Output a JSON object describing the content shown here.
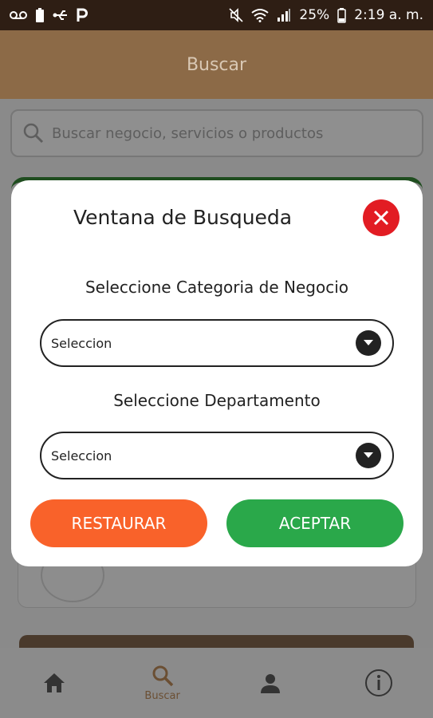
{
  "status_bar": {
    "left_icons": [
      "voicemail-icon",
      "battery-saver-icon",
      "usb-icon",
      "parking-icon"
    ],
    "battery": "25%",
    "time": "2:19 a. m."
  },
  "app_bar": {
    "title": "Buscar"
  },
  "search": {
    "placeholder": "Buscar negocio, servicios o productos"
  },
  "dialog": {
    "title": "Ventana de Busqueda",
    "category_label": "Seleccione Categoria de Negocio",
    "category_value": "Seleccion",
    "department_label": "Seleccione Departamento",
    "department_value": "Seleccion",
    "restore_label": "RESTAURAR",
    "accept_label": "ACEPTAR"
  },
  "bottom_nav": {
    "items": [
      {
        "label": "",
        "icon": "home-icon"
      },
      {
        "label": "Buscar",
        "icon": "search-icon"
      },
      {
        "label": "",
        "icon": "person-icon"
      },
      {
        "label": "",
        "icon": "info-icon"
      }
    ]
  },
  "colors": {
    "app_bar": "#8c6a47",
    "close": "#e21c23",
    "restore": "#f9622a",
    "accept": "#2aa84a"
  }
}
